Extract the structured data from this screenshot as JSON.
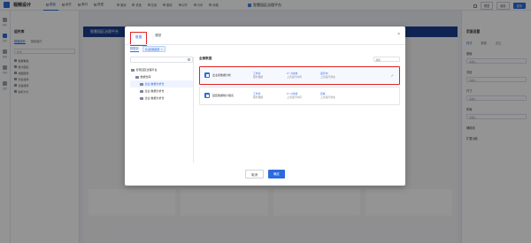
{
  "app": {
    "name": "视频设计"
  },
  "nav": [
    {
      "label": "模板",
      "active": true
    },
    {
      "label": "组件",
      "active": false
    },
    {
      "label": "素材",
      "active": false
    },
    {
      "label": "数据",
      "active": false
    }
  ],
  "toolbar": {
    "buttons": [
      "撤销",
      "重做",
      "复制",
      "删除",
      "对齐",
      "分布",
      "网格"
    ]
  },
  "document": {
    "title": "智慧园区治理平台"
  },
  "top_right": {
    "preview": "预览",
    "save": "保存",
    "publish": "发布"
  },
  "rail": [
    {
      "label": "图层",
      "active": false
    },
    {
      "label": "组件",
      "active": true
    },
    {
      "label": "数据",
      "active": false
    },
    {
      "label": "素材",
      "active": false
    },
    {
      "label": "设置",
      "active": false
    }
  ],
  "left_panel": {
    "title": "组件库",
    "tabs": [
      "数据组件",
      "基础组件"
    ],
    "search_placeholder": "搜索",
    "rows": [
      "数据看板",
      "统计图表",
      "地图组件",
      "列表组件",
      "表格组件",
      "指标卡片"
    ]
  },
  "right_panel": {
    "title": "页面设置",
    "tabs": [
      "样式",
      "数据",
      "交互"
    ],
    "sections": [
      "基础",
      "背景",
      "尺寸",
      "布局",
      "辅助线",
      "扩展功能"
    ],
    "field_placeholder": "请输入"
  },
  "canvas": {
    "header": "智慧园区治理平台"
  },
  "modal": {
    "tabs": [
      {
        "label": "数据",
        "active": true
      },
      {
        "label": "模型",
        "active": false
      }
    ],
    "close": "×",
    "sub_label": "数据源",
    "chip": "企业和数据源",
    "tree": [
      {
        "label": "智慧园区治理平台",
        "indent": 0,
        "selected": false
      },
      {
        "label": "数据仓库",
        "indent": 1,
        "selected": false
      },
      {
        "label": "企业-数据分析仓",
        "indent": 2,
        "selected": true
      },
      {
        "label": "企业-数据分析仓",
        "indent": 2,
        "selected": false
      },
      {
        "label": "企业-数据分析仓",
        "indent": 2,
        "selected": false
      }
    ],
    "list_title": "全部数据",
    "list_search_placeholder": "搜索",
    "datasets": [
      {
        "name": "企业和数据分析",
        "col1": [
          "工作表",
          "服务数据"
        ],
        "col2": [
          "17 小时前",
          "上次运行时间"
        ],
        "col3": [
          "运行中",
          "上次运行状态"
        ],
        "selected": true
      },
      {
        "name": "园区数据统计报表",
        "col1": [
          "工作表",
          "服务数据"
        ],
        "col2": [
          "17 小时前",
          "上次运行时间"
        ],
        "col3": [
          "完成",
          "上次运行状态"
        ],
        "selected": false
      }
    ],
    "cancel": "取消",
    "confirm": "确定"
  },
  "colors": {
    "accent": "#2b6bdf",
    "highlight": "#e02424"
  }
}
